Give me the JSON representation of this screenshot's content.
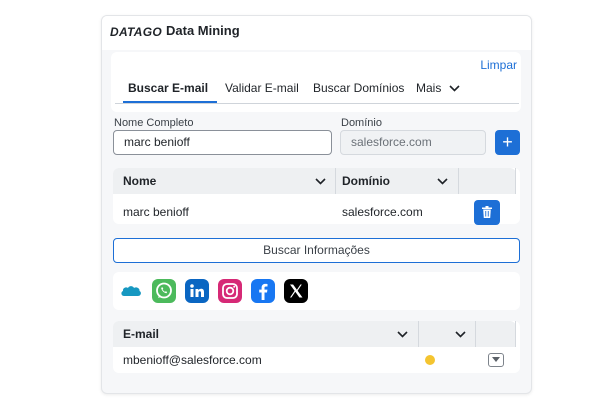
{
  "header": {
    "brand": "DATAGO",
    "title": "Data Mining"
  },
  "actions": {
    "clear_label": "Limpar"
  },
  "tabs": [
    {
      "label": "Buscar E-mail",
      "active": true
    },
    {
      "label": "Validar E-mail",
      "active": false
    },
    {
      "label": "Buscar Domínios",
      "active": false
    },
    {
      "label": "Mais",
      "active": false
    }
  ],
  "form": {
    "name_label": "Nome Completo",
    "name_value": "marc benioff",
    "domain_label": "Domínio",
    "domain_placeholder": "salesforce.com",
    "add_icon": "plus-icon"
  },
  "lookup_table": {
    "columns": [
      "Nome",
      "Domínio"
    ],
    "rows": [
      {
        "name": "marc benioff",
        "domain": "salesforce.com"
      }
    ]
  },
  "search_button_label": "Buscar Informações",
  "social_icons": [
    "salesforce-icon",
    "whatsapp-icon",
    "linkedin-icon",
    "instagram-icon",
    "facebook-icon",
    "x-icon"
  ],
  "results_table": {
    "columns": [
      "E-mail"
    ],
    "rows": [
      {
        "email": "mbenioff@salesforce.com",
        "status_color": "#f4c430"
      }
    ]
  },
  "colors": {
    "accent": "#1d6fd6",
    "status_unknown": "#f4c430"
  }
}
